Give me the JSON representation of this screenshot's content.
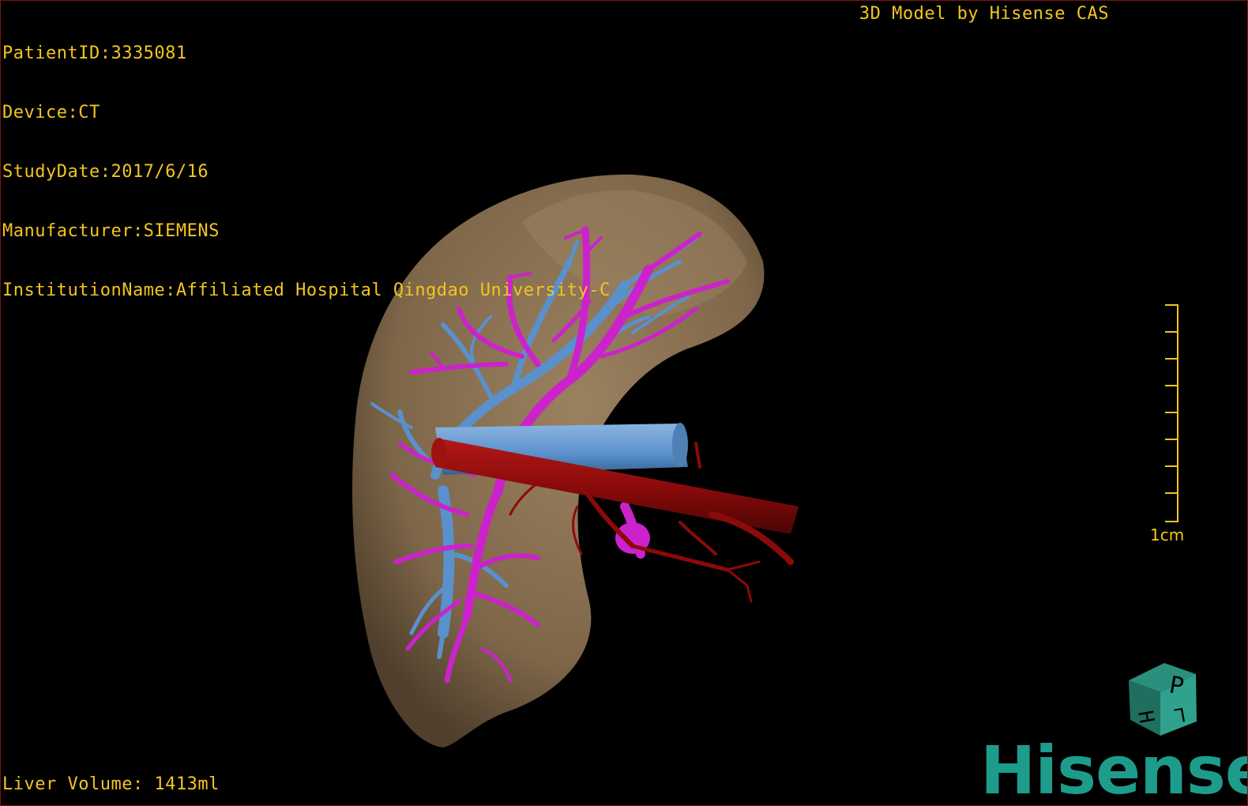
{
  "window": {
    "title": "3D Model by Hisense CAS"
  },
  "patient_info": {
    "patient_id": "PatientID:3335081",
    "device": "Device:CT",
    "study_date": "StudyDate:2017/6/16",
    "manufacturer": "Manufacturer:SIEMENS",
    "institution": "InstitutionName:Affiliated Hospital Qingdao University-C"
  },
  "model_label": "3D Model by Hisense CAS",
  "liver_volume": "Liver Volume: 1413ml",
  "scale": {
    "label": "1cm",
    "ticks": 8
  },
  "orientation_cube": {
    "faces": [
      "P",
      "H",
      "L"
    ]
  },
  "brand": "Hisense",
  "colors": {
    "overlay_text": "#f2c521",
    "liver": "#8a714f",
    "portal_vein": "#cc22cc",
    "hepatic_vein": "#5a90cc",
    "artery_ivc": "#8b0a0a",
    "brand": "#1d9c8c"
  },
  "structures": [
    "liver-surface",
    "portal-vein-tree",
    "hepatic-vein-tree",
    "hepatic-artery-tree"
  ]
}
